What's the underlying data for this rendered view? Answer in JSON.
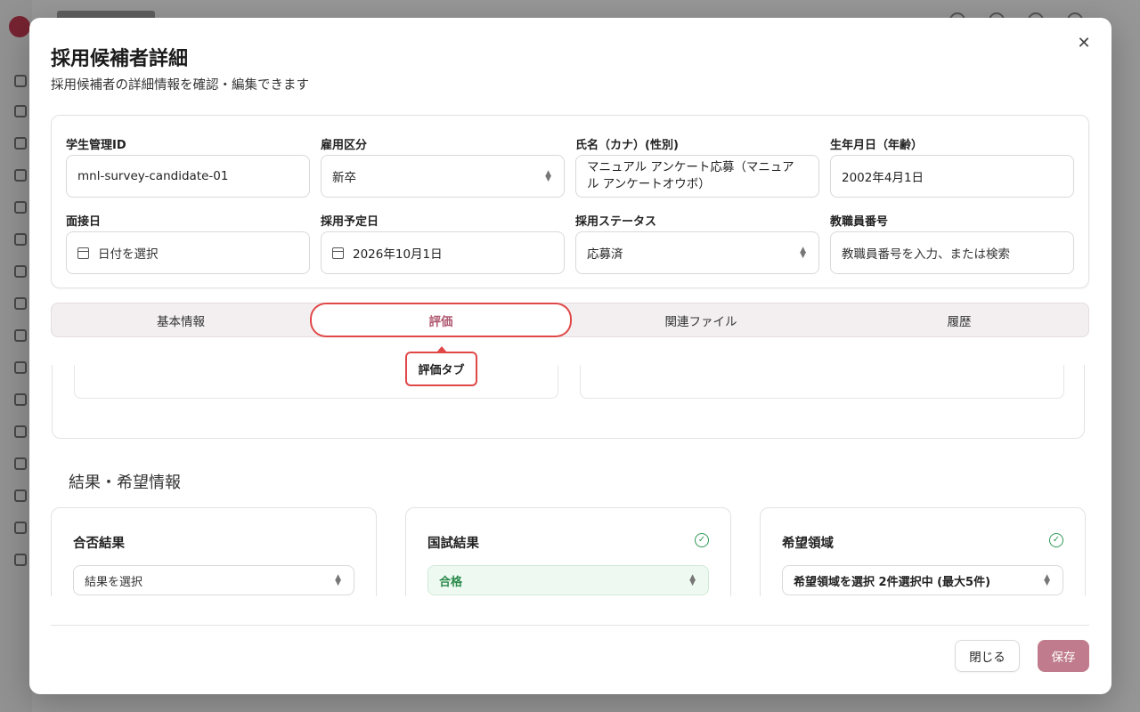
{
  "modal": {
    "title": "採用候補者詳細",
    "subtitle": "採用候補者の詳細情報を確認・編集できます",
    "close_icon": "close-icon"
  },
  "fields": {
    "student_id": {
      "label": "学生管理ID",
      "value": "mnl-survey-candidate-01"
    },
    "employment_type": {
      "label": "雇用区分",
      "value": "新卒"
    },
    "name": {
      "label": "氏名（カナ）(性別)",
      "value": "マニュアル アンケート応募（マニュアル アンケートオウボ）"
    },
    "birthdate": {
      "label": "生年月日（年齢）",
      "value": "2002年4月1日"
    },
    "interview_date": {
      "label": "面接日",
      "placeholder": "日付を選択"
    },
    "planned_hire_date": {
      "label": "採用予定日",
      "value": "2026年10月1日"
    },
    "hire_status": {
      "label": "採用ステータス",
      "value": "応募済"
    },
    "staff_number": {
      "label": "教職員番号",
      "placeholder": "教職員番号を入力、または検索"
    }
  },
  "tabs": [
    {
      "label": "基本情報",
      "active": false
    },
    {
      "label": "評価",
      "active": true
    },
    {
      "label": "関連ファイル",
      "active": false
    },
    {
      "label": "履歴",
      "active": false
    }
  ],
  "tooltip": {
    "text": "評価タブ"
  },
  "results_section": {
    "title": "結果・希望情報",
    "cards": [
      {
        "title": "合否結果",
        "value": "結果を選択",
        "checked": false
      },
      {
        "title": "国試結果",
        "value": "合格",
        "checked": true
      },
      {
        "title": "希望領域",
        "value": "希望領域を選択 2件選択中 (最大5件)",
        "checked": true
      }
    ]
  },
  "footer": {
    "close_label": "閉じる",
    "save_label": "保存"
  },
  "colors": {
    "accent": "#c07c8c",
    "active_tab_text": "#b05a72",
    "highlight": "#e04848",
    "success": "#2e9a55"
  }
}
